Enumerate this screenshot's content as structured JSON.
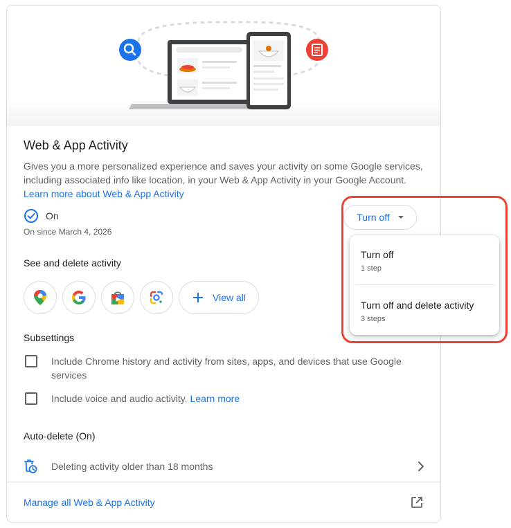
{
  "card": {
    "title": "Web & App Activity",
    "description": "Gives you a more personalized experience and saves your activity on some Google services, including associated info like location, in your Web & App Activity in your Google Account.",
    "learn_more_link": "Learn more about Web & App Activity"
  },
  "status": {
    "label": "On",
    "since": "On since March 4, 2026"
  },
  "turn_off_button": {
    "label": "Turn off"
  },
  "dropdown_menu": {
    "items": [
      {
        "title": "Turn off",
        "subtitle": "1 step"
      },
      {
        "title": "Turn off and delete activity",
        "subtitle": "3 steps"
      }
    ]
  },
  "see_delete": {
    "heading": "See and delete activity",
    "apps": [
      {
        "name": "maps-icon"
      },
      {
        "name": "google-icon"
      },
      {
        "name": "play-store-icon"
      },
      {
        "name": "lens-icon"
      }
    ],
    "view_all_label": "View all"
  },
  "subsettings": {
    "heading": "Subsettings",
    "chrome_history_label": "Include Chrome history and activity from sites, apps, and devices that use Google services",
    "voice_audio_label": "Include voice and audio activity.",
    "voice_learn_more": "Learn more"
  },
  "auto_delete": {
    "heading": "Auto-delete (On)",
    "text": "Deleting activity older than 18 months"
  },
  "footer": {
    "manage_label": "Manage all Web & App Activity"
  },
  "colors": {
    "accent": "#1a73e8",
    "highlight_border": "#ea4335",
    "search_badge": "#1a73e8",
    "doc_badge": "#ea4335"
  }
}
